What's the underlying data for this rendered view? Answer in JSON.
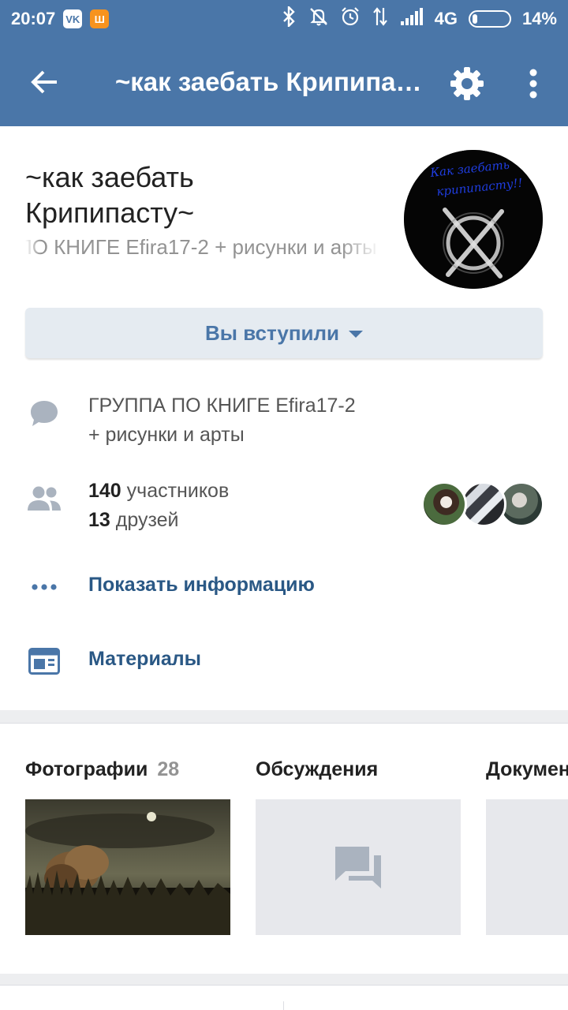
{
  "status_bar": {
    "time": "20:07",
    "app1": "VK",
    "app2": "Ш",
    "network": "4G",
    "battery": "14%",
    "battery_level": 0.14,
    "icons": [
      "bluetooth-icon",
      "muted-bell-icon",
      "alarm-icon",
      "data-arrows-icon",
      "signal-icon"
    ]
  },
  "header": {
    "title": "~как заебать Крипипасту~",
    "back_icon": "arrow-left-icon",
    "settings_icon": "gear-icon",
    "more_icon": "vertical-dots-icon"
  },
  "group": {
    "name_line1": "~как заебать",
    "name_line2": "Крипипасту~",
    "status": "ПО КНИГЕ Efira17-2 + рисунки и арты",
    "avatar_text_line1": "Как заебать",
    "avatar_text_line2": "крипипасту!!"
  },
  "join_button": {
    "label": "Вы вступили"
  },
  "info": {
    "description_line1": "ГРУППА ПО КНИГЕ Efira17-2",
    "description_line2": "+ рисунки и арты",
    "members_count": "140",
    "members_label": "участников",
    "friends_count": "13",
    "friends_label": "друзей",
    "show_info": "Показать информацию",
    "materials": "Материалы"
  },
  "sections": [
    {
      "title": "Фотографии",
      "count": "28"
    },
    {
      "title": "Обсуждения"
    },
    {
      "title": "Документы"
    }
  ],
  "colors": {
    "brand": "#4a76a8",
    "link": "#2a5885",
    "muted": "#939393",
    "button_bg": "#e5ebf1"
  }
}
